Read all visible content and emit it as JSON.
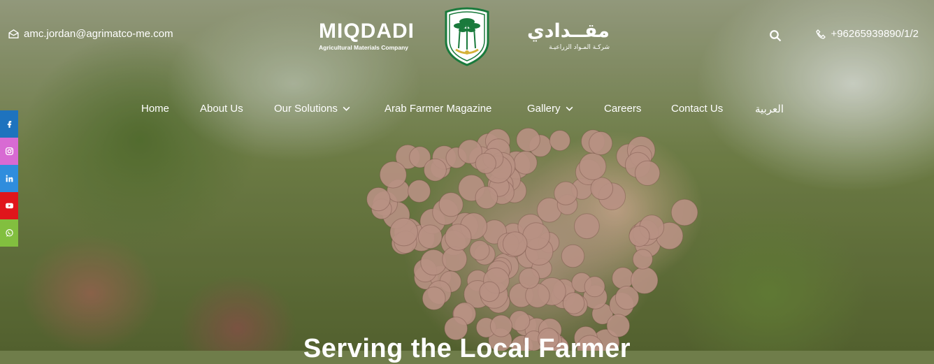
{
  "header": {
    "email": "amc.jordan@agrimatco-me.com",
    "phone": "+96265939890/1/2",
    "logo_en_name": "MIQDADI",
    "logo_en_sub": "Agricultural Materials Company",
    "logo_ar_name": "مقــدادي",
    "logo_ar_sub": "شركـة المـواد الزراعيـة"
  },
  "nav": {
    "home": "Home",
    "about": "About Us",
    "solutions": "Our Solutions",
    "magazine": "Arab Farmer Magazine",
    "gallery": "Gallery",
    "careers": "Careers",
    "contact": "Contact Us",
    "arabic": "العربية"
  },
  "social": {
    "colors": {
      "facebook": "#1e73be",
      "instagram": "#d86ad3",
      "linkedin": "#2f8ddd",
      "youtube": "#e0161b",
      "whatsapp": "#82bf3f"
    }
  },
  "hero": {
    "title": "Serving the Local Farmer"
  },
  "colors": {
    "emblem_green": "#1a7a3c",
    "emblem_gold": "#d5b23a"
  }
}
